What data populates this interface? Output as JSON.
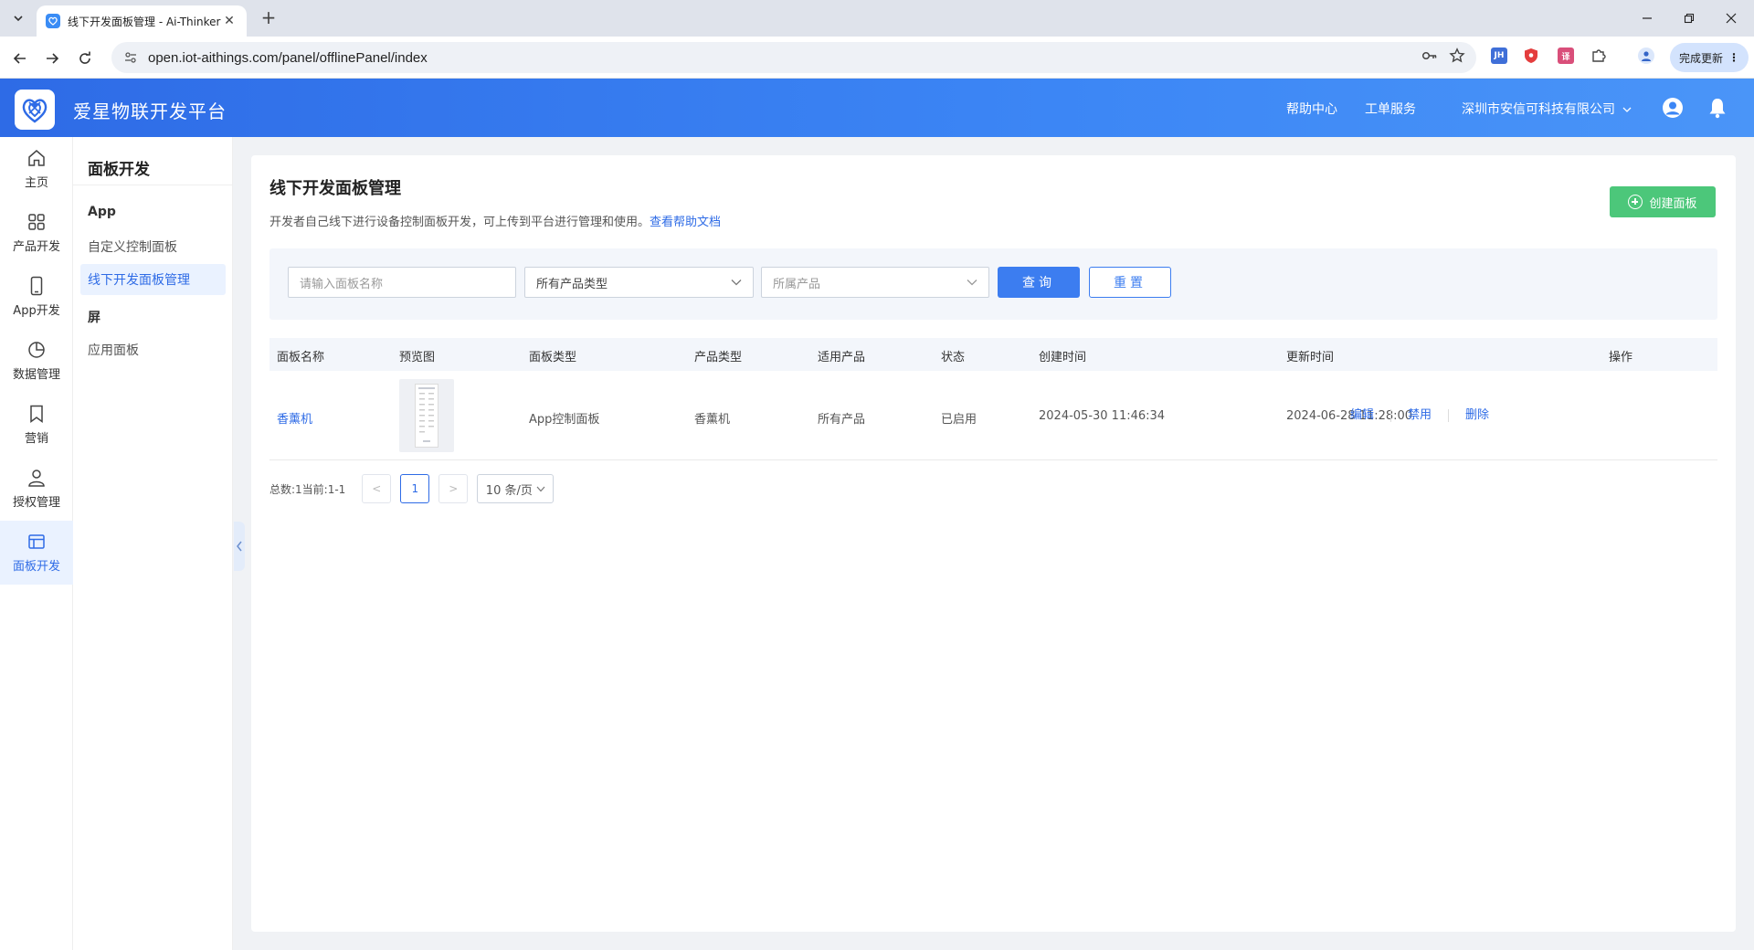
{
  "browser": {
    "tab_title": "线下开发面板管理 - Ai-Thinker",
    "tab_close": "✕",
    "new_tab": "+",
    "url": "open.iot-aithings.com/panel/offlinePanel/index",
    "update_label": "完成更新",
    "extensions": [
      {
        "name": "JH",
        "color": "#3f6fd8"
      },
      {
        "name": "shield",
        "color": "#e43d3d"
      },
      {
        "name": "translate",
        "color": "#d94f7a"
      }
    ]
  },
  "header": {
    "title": "爱星物联开发平台",
    "links": {
      "help": "帮助中心",
      "ticket": "工单服务",
      "company": "深圳市安信可科技有限公司"
    }
  },
  "iconbar": {
    "items": [
      {
        "label": "主页",
        "icon": "home-icon"
      },
      {
        "label": "产品开发",
        "icon": "grid-icon"
      },
      {
        "label": "App开发",
        "icon": "phone-icon"
      },
      {
        "label": "数据管理",
        "icon": "pie-chart-icon"
      },
      {
        "label": "营销",
        "icon": "bookmark-icon"
      },
      {
        "label": "授权管理",
        "icon": "user-icon"
      },
      {
        "label": "面板开发",
        "icon": "panel-icon"
      }
    ],
    "active_index": 6
  },
  "submenu": {
    "title": "面板开发",
    "groups": [
      {
        "label": "App",
        "items": [
          "自定义控制面板",
          "线下开发面板管理"
        ]
      },
      {
        "label": "屏",
        "items": [
          "应用面板"
        ]
      }
    ],
    "active_item": "线下开发面板管理"
  },
  "page": {
    "title": "线下开发面板管理",
    "description": "开发者自己线下进行设备控制面板开发，可上传到平台进行管理和使用。",
    "help_link": "查看帮助文档",
    "create_button": "创建面板"
  },
  "filters": {
    "name_placeholder": "请输入面板名称",
    "product_type": "所有产品类型",
    "product_placeholder": "所属产品",
    "query_button": "查询",
    "reset_button": "重置"
  },
  "table": {
    "columns": [
      "面板名称",
      "预览图",
      "面板类型",
      "产品类型",
      "适用产品",
      "状态",
      "创建时间",
      "更新时间",
      "操作"
    ],
    "rows": [
      {
        "name": "香薰机",
        "panel_type": "App控制面板",
        "product_type": "香薰机",
        "applicable_product": "所有产品",
        "status": "已启用",
        "created": "2024-05-30 11:46:34",
        "updated": "2024-06-28 11:28:00",
        "actions": [
          "编辑",
          "禁用",
          "删除"
        ]
      }
    ]
  },
  "pagination": {
    "summary": "总数:1当前:1-1",
    "prev": "<",
    "next": ">",
    "current_page": "1",
    "page_size": "10 条/页"
  }
}
